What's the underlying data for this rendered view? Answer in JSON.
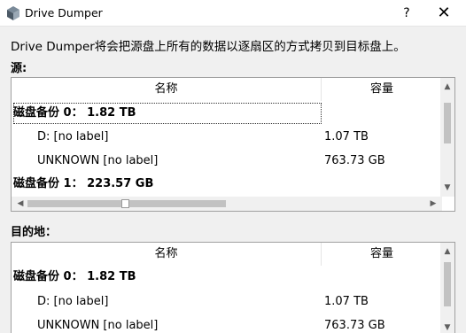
{
  "window": {
    "title": "Drive Dumper",
    "help_label": "?",
    "close_label": "✕"
  },
  "description": "Drive Dumper将会把源盘上所有的数据以逐扇区的方式拷贝到目标盘上。",
  "source": {
    "label": "源:",
    "columns": {
      "name": "名称",
      "size": "容量"
    },
    "rows": [
      {
        "name": "磁盘备份 0：  1.82 TB",
        "size": ""
      },
      {
        "name": "D: [no label]",
        "size": "1.07 TB"
      },
      {
        "name": "UNKNOWN [no label]",
        "size": "763.73 GB"
      },
      {
        "name": "磁盘备份 1：  223.57 GB",
        "size": ""
      }
    ]
  },
  "destination": {
    "label": "目的地：",
    "columns": {
      "name": "名称",
      "size": "容量"
    },
    "rows": [
      {
        "name": "磁盘备份 0：  1.82 TB",
        "size": ""
      },
      {
        "name": "D: [no label]",
        "size": "1.07 TB"
      },
      {
        "name": "UNKNOWN [no label]",
        "size": "763.73 GB"
      }
    ]
  },
  "icons": {
    "app": "drive-dumper-app-icon",
    "up": "▲",
    "down": "▼",
    "left": "◀",
    "right": "▶"
  }
}
